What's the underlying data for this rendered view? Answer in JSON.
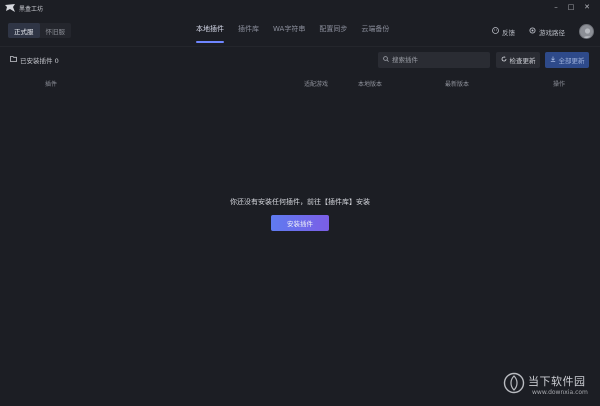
{
  "titlebar": {
    "app_title": "黑盒工坊",
    "minimize_glyph": "–",
    "maximize_glyph": "□",
    "close_glyph": "✕",
    "logo_icon": "blackbox-logo-icon"
  },
  "mode_switch": {
    "items": [
      {
        "label": "正式服",
        "active": true
      },
      {
        "label": "怀旧服",
        "active": false
      }
    ]
  },
  "tabs": [
    {
      "label": "本地插件",
      "active": true
    },
    {
      "label": "插件库",
      "active": false
    },
    {
      "label": "WA字符串",
      "active": false
    },
    {
      "label": "配置同步",
      "active": false
    },
    {
      "label": "云端备份",
      "active": false
    }
  ],
  "header_right": {
    "feedback_label": "反馈",
    "feedback_icon": "feedback-icon",
    "game_path_label": "游戏路径",
    "game_path_icon": "gear-icon"
  },
  "toolbar": {
    "installed_label": "已安装插件 0",
    "installed_icon": "folder-icon",
    "search_placeholder": "搜索插件",
    "search_icon": "search-icon",
    "check_update_label": "检查更新",
    "check_update_icon": "refresh-icon",
    "update_all_label": "全部更新",
    "update_all_icon": "download-icon"
  },
  "table": {
    "columns": [
      "插件",
      "适配游戏",
      "本地版本",
      "最新版本",
      "操作"
    ],
    "rows": []
  },
  "empty_state": {
    "message": "你还没有安装任何插件，前往【插件库】安装",
    "install_button_label": "安装插件"
  },
  "watermark": {
    "text": "当下软件园",
    "url": "www.downxia.com"
  },
  "colors": {
    "background": "#1c1e24",
    "accent": "#6f86ff",
    "install_gradient_start": "#5f7bf0",
    "install_gradient_end": "#7b5ee6",
    "update_all_bg": "#2e4a8a"
  }
}
